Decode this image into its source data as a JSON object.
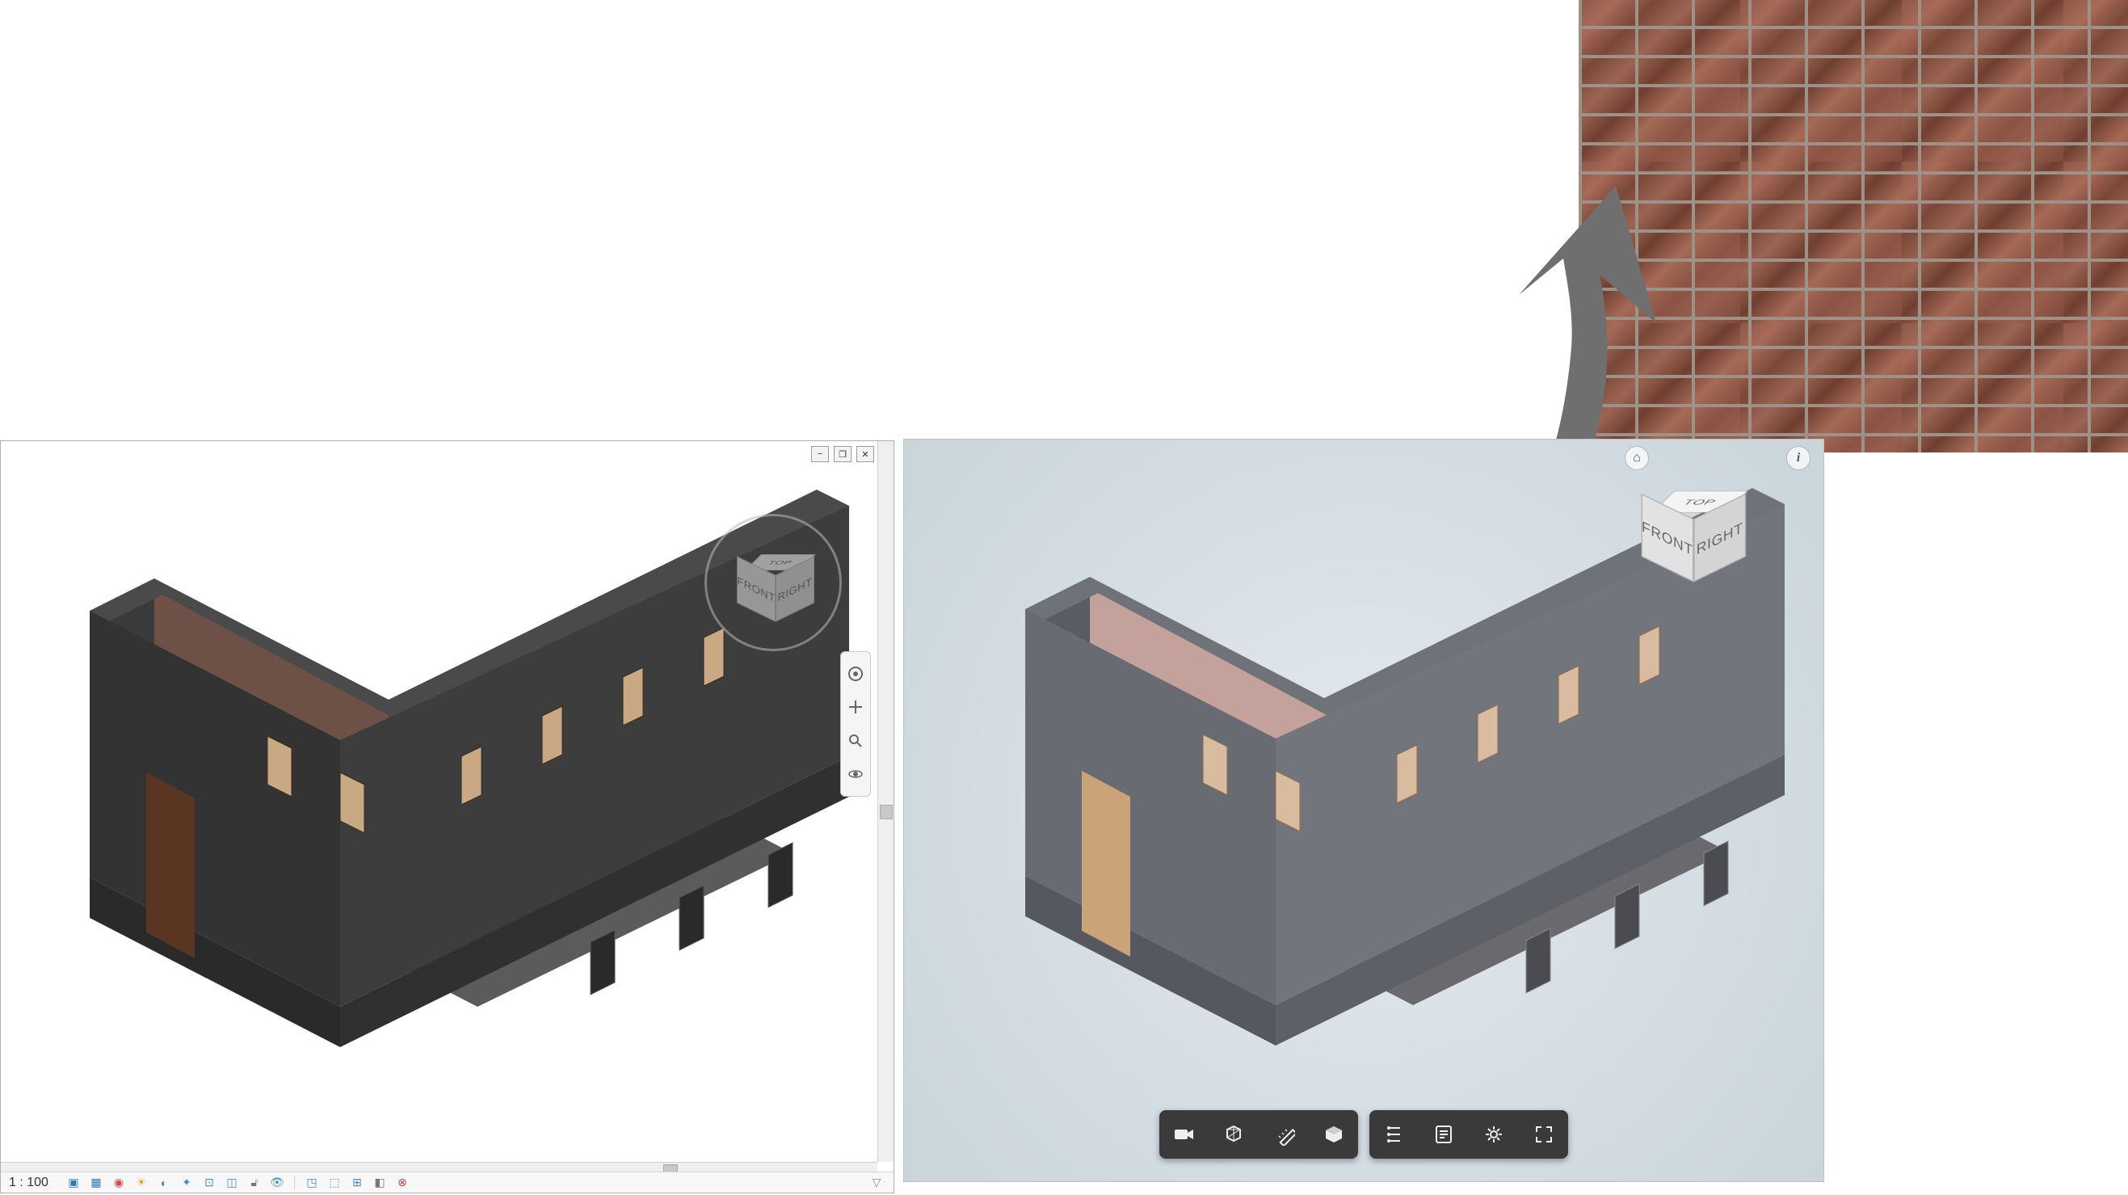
{
  "swatch": {
    "name": "brick-texture"
  },
  "arrow": {
    "name": "material-arrow"
  },
  "left": {
    "window_controls": {
      "minimize": "−",
      "maximize": "❐",
      "close": "✕"
    },
    "viewcube": {
      "top": "TOP",
      "front": "FRONT",
      "right": "RIGHT"
    },
    "navbar": {
      "wheel": "steering-wheel",
      "pan": "pan",
      "zoom": "zoom",
      "orbit": "orbit"
    },
    "statusbar": {
      "scale": "1 : 100",
      "icons": [
        "display-model-icon",
        "detail-level-icon",
        "visual-style-icon",
        "sun-path-icon",
        "shadows-icon",
        "rendering-icon",
        "crop-view-icon",
        "crop-region-icon",
        "unlock-icon",
        "temp-hide-icon",
        "reveal-hidden-icon",
        "worksharing-icon",
        "analytical-icon",
        "highlight-icon",
        "reveal-constraints-icon"
      ]
    }
  },
  "right": {
    "topright": {
      "home": "⌂",
      "info": "i"
    },
    "viewcube": {
      "top": "TOP",
      "front": "FRONT",
      "right": "RIGHT"
    },
    "toolbar": {
      "group1": [
        {
          "name": "camera-button",
          "icon": "camera"
        },
        {
          "name": "explode-button",
          "icon": "cube-explode"
        },
        {
          "name": "measure-button",
          "icon": "ruler"
        },
        {
          "name": "section-button",
          "icon": "cube"
        }
      ],
      "group2": [
        {
          "name": "model-browser-button",
          "icon": "tree"
        },
        {
          "name": "properties-button",
          "icon": "properties"
        },
        {
          "name": "settings-button",
          "icon": "gear"
        },
        {
          "name": "fullscreen-button",
          "icon": "fullscreen"
        }
      ]
    }
  }
}
